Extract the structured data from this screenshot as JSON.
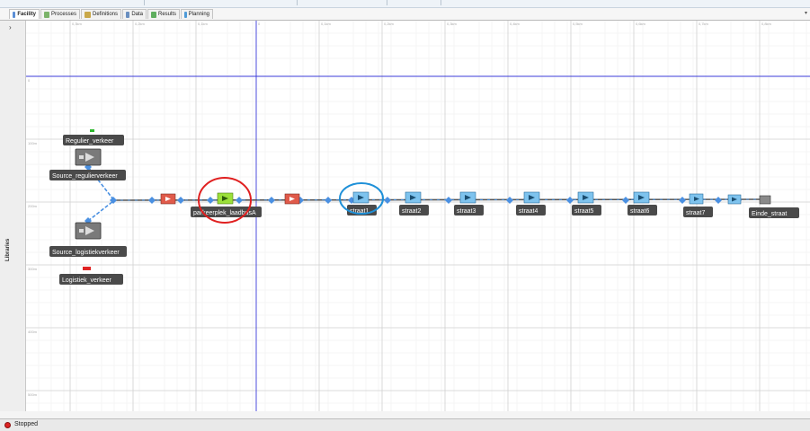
{
  "tabs": [
    {
      "label": "Facility",
      "active": true,
      "icon": "facility-icon"
    },
    {
      "label": "Processes",
      "active": false,
      "icon": "processes-icon"
    },
    {
      "label": "Definitions",
      "active": false,
      "icon": "definitions-icon"
    },
    {
      "label": "Data",
      "active": false,
      "icon": "data-icon"
    },
    {
      "label": "Results",
      "active": false,
      "icon": "results-icon"
    },
    {
      "label": "Planning",
      "active": false,
      "icon": "planning-icon"
    }
  ],
  "sidebar": {
    "label": "Libraries",
    "collapse_glyph": "›"
  },
  "status": {
    "text": "Stopped",
    "color": "#d22222"
  },
  "canvas": {
    "ruler_top": [
      "0,3km",
      "0,2km",
      "0,1km",
      "0",
      "0,1km",
      "0,2km",
      "0,3km",
      "0,4km",
      "0,5km",
      "0,6km",
      "0,7km",
      "0,8km"
    ],
    "ruler_left": [
      "0",
      "100m",
      "200m",
      "300m",
      "400m",
      "500m"
    ],
    "nodes": {
      "regulier_verkeer": "Regulier_verkeer",
      "source_regulierverkeer": "Source_regulierverkeer",
      "source_logistiekverkeer": "Source_logistiekverkeer",
      "logistiek_verkeer": "Logistiek_verkeer",
      "parkeerplek": "parkeerplek_laadbusA",
      "straat1": "straat1",
      "straat2": "straat2",
      "straat3": "straat3",
      "straat4": "straat4",
      "straat5": "straat5",
      "straat6": "straat6",
      "straat7": "straat7",
      "einde": "Einde_straat"
    },
    "highlights": {
      "red_circle": "#e02020",
      "blue_circle": "#1e90d8"
    },
    "colors": {
      "link": "#555555",
      "link_dash": "#3b8ee8",
      "server": "#7ec3ee",
      "server_active": "#9be03a",
      "server_failed": "#e05a4a"
    }
  }
}
